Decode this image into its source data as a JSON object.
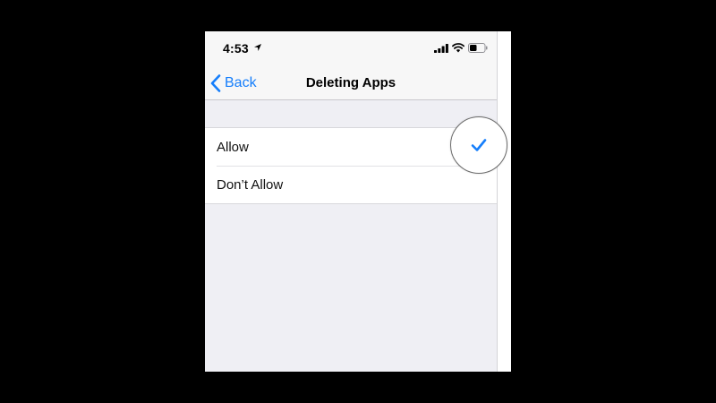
{
  "status_bar": {
    "time": "4:53",
    "icons": [
      "location-arrow-icon",
      "cellular-signal-icon",
      "wifi-icon",
      "battery-icon"
    ]
  },
  "nav": {
    "back_label": "Back",
    "title": "Deleting Apps"
  },
  "options": [
    {
      "label": "Allow",
      "selected": true
    },
    {
      "label": "Don’t Allow",
      "selected": false
    }
  ],
  "colors": {
    "accent": "#157efb",
    "background": "#efeff4",
    "frame": "#000000"
  }
}
